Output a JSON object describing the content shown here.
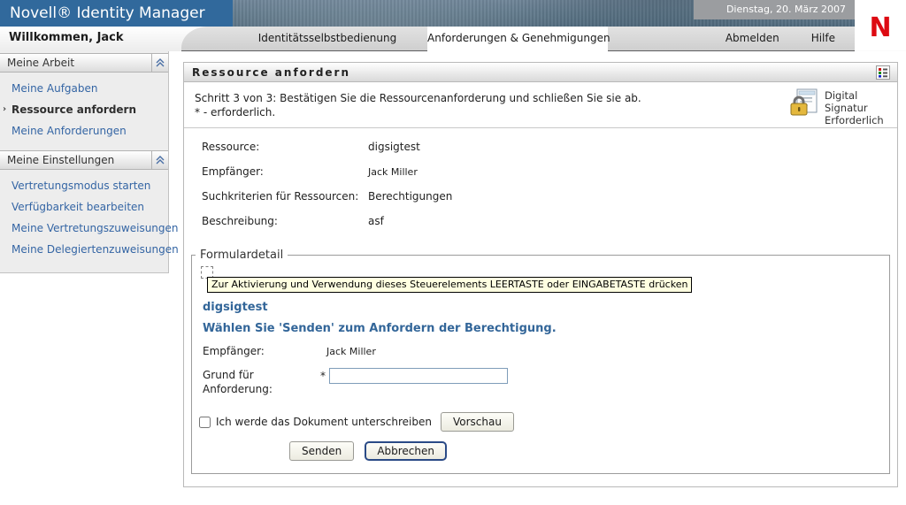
{
  "banner": {
    "app_title": "Novell® Identity Manager",
    "date": "Dienstag, 20. März 2007",
    "logo_letter": "N"
  },
  "nav": {
    "welcome": "Willkommen, Jack",
    "tabs": [
      {
        "label": "Identitätsselbstbedienung",
        "active": false
      },
      {
        "label": "Anforderungen & Genehmigungen",
        "active": true
      }
    ],
    "logout_label": "Abmelden",
    "help_label": "Hilfe"
  },
  "sidebar": {
    "sections": [
      {
        "title": "Meine Arbeit",
        "items": [
          {
            "label": "Meine Aufgaben",
            "active": false
          },
          {
            "label": "Ressource anfordern",
            "active": true
          },
          {
            "label": "Meine Anforderungen",
            "active": false
          }
        ]
      },
      {
        "title": "Meine Einstellungen",
        "items": [
          {
            "label": "Vertretungsmodus starten",
            "active": false
          },
          {
            "label": "Verfügbarkeit bearbeiten",
            "active": false
          },
          {
            "label": "Meine Vertretungszuweisungen",
            "active": false
          },
          {
            "label": "Meine Delegiertenzuweisungen",
            "active": false
          }
        ]
      }
    ]
  },
  "panel": {
    "title": "Ressource anfordern",
    "step_text": "Schritt 3 von 3: Bestätigen Sie die Ressourcenanforderung und schließen Sie sie ab.",
    "required_hint": "* - erforderlich.",
    "digital_signature_label": "Digital Signatur Erforderlich",
    "summary": {
      "rows": [
        {
          "label": "Ressource:",
          "value": "digsigtest"
        },
        {
          "label": "Empfänger:",
          "value": "Jack Miller"
        },
        {
          "label": "Suchkriterien für Ressourcen:",
          "value": "Berechtigungen"
        },
        {
          "label": "Beschreibung:",
          "value": "asf"
        }
      ]
    },
    "form": {
      "legend": "Formulardetail",
      "control_tooltip": "Zur Aktivierung und Verwendung dieses Steuerelements LEERTASTE oder EINGABETASTE drücken",
      "resource_name": "digsigtest",
      "instruction": "Wählen Sie 'Senden' zum Anfordern der Berechtigung.",
      "recipient_label": "Empfänger:",
      "recipient_value": "Jack Miller",
      "reason_label": "Grund für Anforderung:",
      "required_marker": "*",
      "reason_value": "",
      "sign_checkbox_label": "Ich werde das Dokument unterschreiben",
      "sign_checked": false,
      "preview_button": "Vorschau",
      "submit_button": "Senden",
      "cancel_button": "Abbrechen"
    }
  },
  "colors": {
    "banner_blue": "#31699c",
    "novell_red": "#dd0a12",
    "link_blue": "#3465a4",
    "accent_blue": "#336699",
    "tooltip_yellow": "#ffffe1"
  }
}
